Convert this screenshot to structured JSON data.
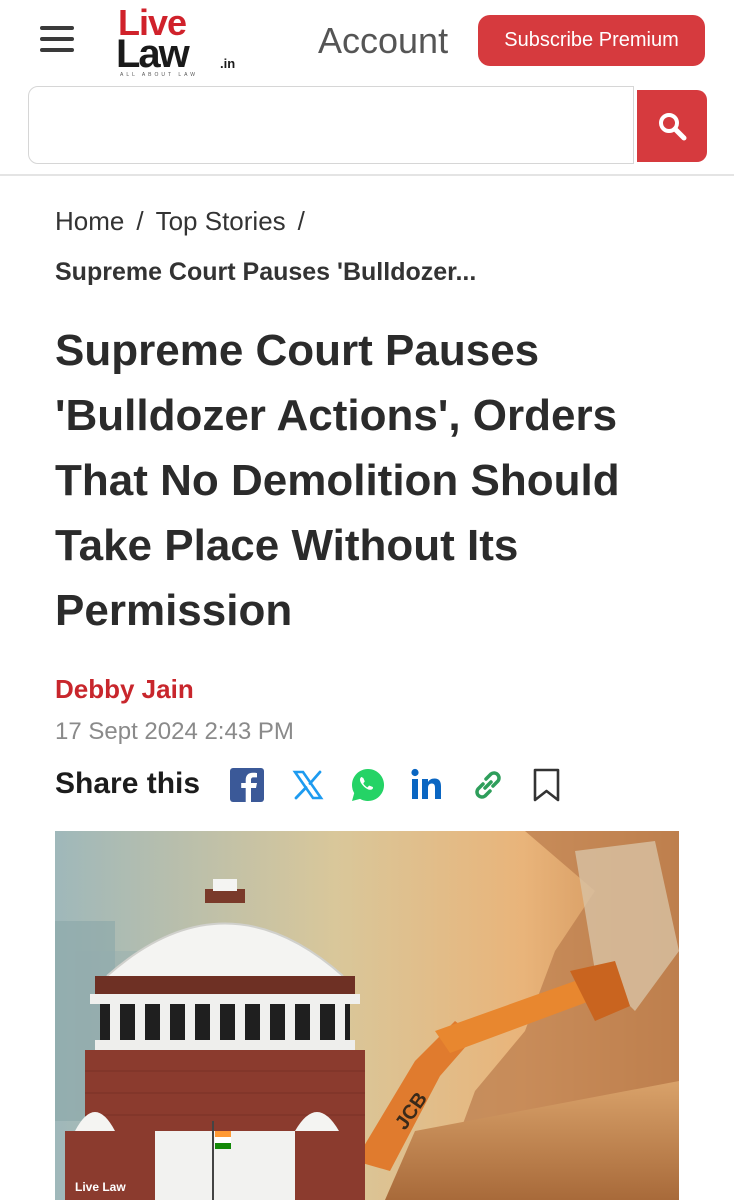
{
  "header": {
    "logo_top": "Live",
    "logo_bottom": "Law",
    "logo_suffix": ".in",
    "logo_tagline": "ALL ABOUT LAW",
    "account_label": "Account",
    "subscribe_label": "Subscribe Premium"
  },
  "search": {
    "placeholder": "",
    "value": ""
  },
  "breadcrumb": {
    "items": [
      {
        "label": "Home"
      },
      {
        "label": "Top Stories"
      }
    ],
    "separator": "/",
    "current": "Supreme Court Pauses 'Bulldozer..."
  },
  "article": {
    "headline": "Supreme Court Pauses 'Bulldozer Actions', Orders That No Demolition Should Take Place Without Its Permission",
    "author": "Debby Jain",
    "date": "17 Sept 2024 2:43 PM",
    "share_label": "Share this",
    "share_icons": [
      "facebook-icon",
      "x-icon",
      "whatsapp-icon",
      "linkedin-icon",
      "link-icon",
      "bookmark-icon"
    ],
    "image_watermark": "Live Law"
  },
  "colors": {
    "brand_red": "#d63a3e",
    "author_red": "#c8262c",
    "facebook": "#3b5998",
    "x": "#1d9bf0",
    "whatsapp": "#25d366",
    "linkedin": "#0a66c2",
    "link": "#2e9e5b"
  }
}
